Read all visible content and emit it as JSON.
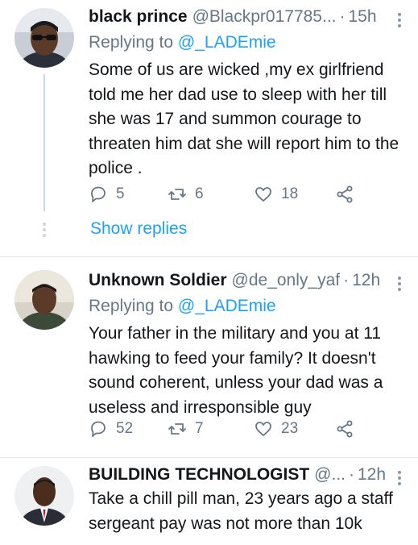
{
  "tweets": [
    {
      "name": "black prince",
      "handle": "@Blackpr017785...",
      "time": "15h",
      "replying_label": "Replying to",
      "replying_handle": "@_LADEmie",
      "text": "Some of us are wicked ,my ex girlfriend told me her dad use to sleep with her till she was 17 and summon courage to threaten him dat she will report him to the police .",
      "replies": "5",
      "retweets": "6",
      "likes": "18",
      "show_replies": "Show replies"
    },
    {
      "name": "Unknown Soldier",
      "handle": "@de_only_yaf",
      "time": "12h",
      "replying_label": "Replying to",
      "replying_handle": "@_LADEmie",
      "text": "Your father in the military and you at 11 hawking to feed your family? It doesn't sound coherent, unless your dad was a useless and irresponsible guy",
      "replies": "52",
      "retweets": "7",
      "likes": "23"
    },
    {
      "name": "BUILDING TECHNOLOGIST",
      "handle": "@...",
      "time": "12h",
      "text": "Take a chill pill man, 23 years ago a staff sergeant pay was not more than 10k"
    }
  ],
  "icons": {
    "reply": "reply-icon",
    "retweet": "retweet-icon",
    "like": "heart-icon",
    "share": "share-icon",
    "more": "more-vertical-icon"
  },
  "colors": {
    "link": "#1da1f2",
    "secondary_text": "#657786",
    "primary_text": "#14171a",
    "separator": "#e1e8ed"
  }
}
